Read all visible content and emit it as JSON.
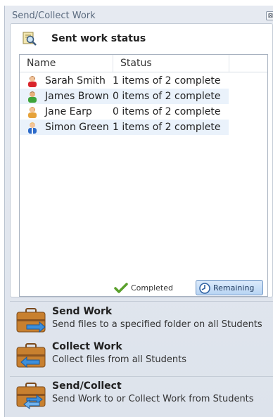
{
  "window": {
    "title": "Send/Collect Work",
    "close_glyph": "⊠"
  },
  "status_section": {
    "title": "Sent work status",
    "icon": "search-document-icon",
    "columns": {
      "name": "Name",
      "status": "Status"
    },
    "rows": [
      {
        "name": "Sarah Smith",
        "status": "1 items of 2 complete",
        "avatar": "student-female-red-icon"
      },
      {
        "name": "James Brown",
        "status": "0 items of 2 complete",
        "avatar": "student-male-green-icon"
      },
      {
        "name": "Jane Earp",
        "status": "0 items of 2 complete",
        "avatar": "student-female-orange-icon"
      },
      {
        "name": "Simon Green",
        "status": "1 items of 2 complete",
        "avatar": "student-male-blue-icon"
      }
    ],
    "legend": {
      "completed": "Completed",
      "remaining": "Remaining"
    }
  },
  "actions": [
    {
      "title": "Send Work",
      "description": "Send files to a specified folder on all Students",
      "icon": "briefcase-send-icon"
    },
    {
      "title": "Collect Work",
      "description": "Collect files from all Students",
      "icon": "briefcase-collect-icon"
    },
    {
      "title": "Send/Collect",
      "description": "Send Work to or Collect Work from Students",
      "icon": "briefcase-sendcollect-icon"
    }
  ],
  "colors": {
    "accent": "#6d93c2",
    "row_highlight": "#eaf2fb",
    "panel_bg": "#e6eaf1"
  }
}
